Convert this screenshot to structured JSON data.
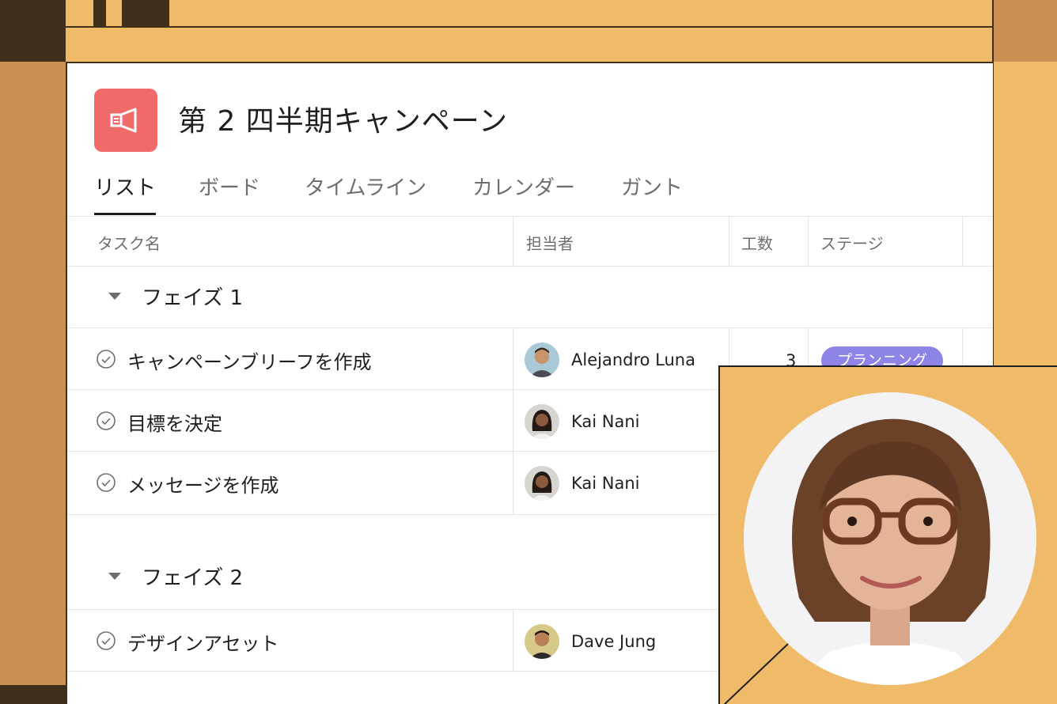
{
  "project": {
    "title": "第 2 四半期キャンペーン",
    "icon": "megaphone-icon",
    "icon_color": "#f06a6a"
  },
  "tabs": [
    {
      "label": "リスト",
      "active": true
    },
    {
      "label": "ボード",
      "active": false
    },
    {
      "label": "タイムライン",
      "active": false
    },
    {
      "label": "カレンダー",
      "active": false
    },
    {
      "label": "ガント",
      "active": false
    }
  ],
  "columns": {
    "task": "タスク名",
    "assignee": "担当者",
    "effort": "工数",
    "stage": "ステージ"
  },
  "sections": [
    {
      "name": "フェイズ 1",
      "tasks": [
        {
          "name": "キャンペーンブリーフを作成",
          "assignee": "Alejandro Luna",
          "effort": "3",
          "stage": "プランニング"
        },
        {
          "name": "目標を決定",
          "assignee": "Kai Nani"
        },
        {
          "name": "メッセージを作成",
          "assignee": "Kai Nani"
        }
      ]
    },
    {
      "name": "フェイズ 2",
      "tasks": [
        {
          "name": "デザインアセット",
          "assignee": "Dave Jung"
        }
      ]
    }
  ],
  "colors": {
    "background": "#efbb68",
    "dark": "#3f3019",
    "stage_badge": "#8d84e8"
  }
}
